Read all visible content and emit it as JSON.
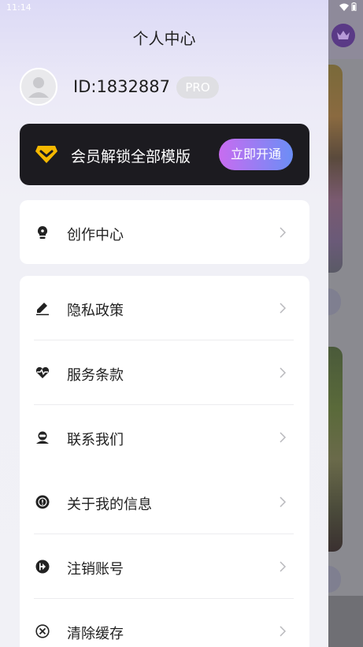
{
  "status_bar": {
    "time": "11:14"
  },
  "header": {
    "title": "个人中心"
  },
  "profile": {
    "user_id": "ID:1832887",
    "badge": "PRO"
  },
  "vip_banner": {
    "text": "会员解锁全部模版",
    "button_label": "立即开通",
    "accent": "#f5b800"
  },
  "menu_group_1": [
    {
      "label": "创作中心",
      "icon": "lightbulb-icon"
    }
  ],
  "menu_group_2": [
    {
      "label": "隐私政策",
      "icon": "pen-icon"
    },
    {
      "label": "服务条款",
      "icon": "heart-pulse-icon"
    },
    {
      "label": "联系我们",
      "icon": "support-agent-icon"
    },
    {
      "label": "关于我的信息",
      "icon": "info-icon"
    },
    {
      "label": "注销账号",
      "icon": "logout-icon"
    },
    {
      "label": "清除缓存",
      "icon": "clear-cache-icon"
    }
  ]
}
